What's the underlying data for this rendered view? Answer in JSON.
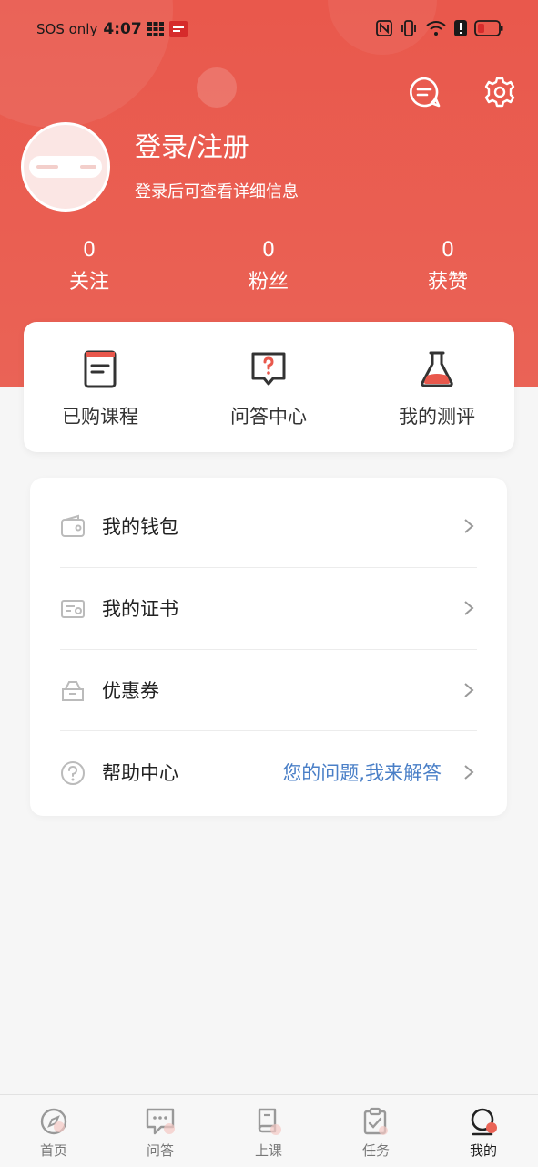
{
  "status_bar": {
    "carrier": "SOS only",
    "time": "4:07",
    "battery_level": 0.3
  },
  "header": {
    "login_title": "登录/注册",
    "login_subtitle": "登录后可查看详细信息",
    "stats": [
      {
        "value": "0",
        "label": "关注"
      },
      {
        "value": "0",
        "label": "粉丝"
      },
      {
        "value": "0",
        "label": "获赞"
      }
    ]
  },
  "quick_actions": [
    {
      "label": "已购课程",
      "icon": "purchased-courses-icon"
    },
    {
      "label": "问答中心",
      "icon": "qa-center-icon"
    },
    {
      "label": "我的测评",
      "icon": "flask-icon"
    }
  ],
  "menu": [
    {
      "label": "我的钱包",
      "icon": "wallet-icon",
      "extra": ""
    },
    {
      "label": "我的证书",
      "icon": "certificate-icon",
      "extra": ""
    },
    {
      "label": "优惠券",
      "icon": "coupon-icon",
      "extra": ""
    },
    {
      "label": "帮助中心",
      "icon": "help-icon",
      "extra": "您的问题,我来解答"
    }
  ],
  "tabs": [
    {
      "label": "首页",
      "icon": "compass-icon",
      "active": false
    },
    {
      "label": "问答",
      "icon": "chat-icon",
      "active": false
    },
    {
      "label": "上课",
      "icon": "book-icon",
      "active": false
    },
    {
      "label": "任务",
      "icon": "clipboard-icon",
      "active": false
    },
    {
      "label": "我的",
      "icon": "profile-icon",
      "active": true
    }
  ],
  "colors": {
    "brand": "#e9584c",
    "link": "#4a7fc7"
  }
}
